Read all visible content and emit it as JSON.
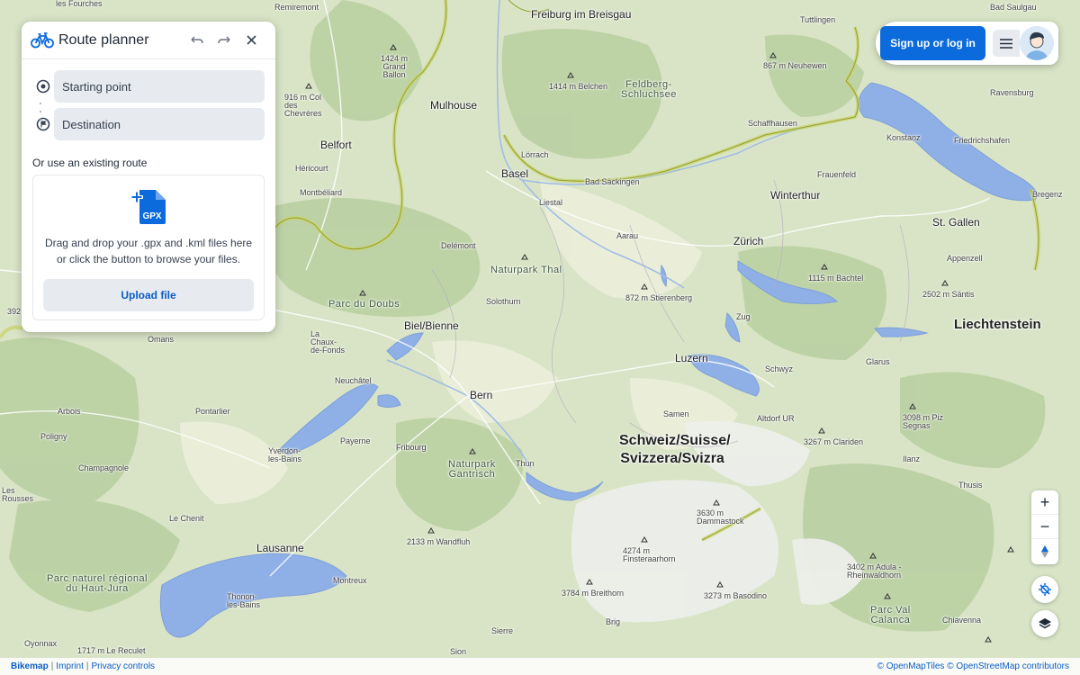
{
  "planner": {
    "title": "Route planner",
    "start_placeholder": "Starting point",
    "destination_placeholder": "Destination",
    "existing_label": "Or use an existing route",
    "file_badge": "GPX",
    "drop_line1": "Drag and drop your .gpx and .kml files here",
    "drop_line2": "or click the button to browse your files.",
    "upload_label": "Upload file",
    "accent_color": "#0b6bdc"
  },
  "header": {
    "signup_label": "Sign up or log in"
  },
  "map": {
    "labels": {
      "freiburg": "Freiburg im Breisgau",
      "mulhouse": "Mulhouse",
      "belfort": "Belfort",
      "basel": "Basel",
      "winterthur": "Winterthur",
      "zurich": "Zürich",
      "stgallen": "St. Gallen",
      "liechtenstein": "Liechtenstein",
      "bielbienne": "Biel/Bienne",
      "luzern": "Luzern",
      "bern": "Bern",
      "country1": "Schweiz/Suisse/",
      "country2": "Svizzera/Svizra",
      "lausanne": "Lausanne",
      "parcdoubs": "Parc du Doubs",
      "naturparkthal": "Naturpark Thal",
      "feldberg1": "Feldberg-",
      "feldberg2": "Schluchsee",
      "gantrisch1": "Naturpark",
      "gantrisch2": "Gantrisch",
      "hautjura1": "Parc naturel régional",
      "hautjura2": "du Haut-Jura",
      "parcval1": "Parc Val",
      "parcval2": "Calanca",
      "schaffhausen": "Schaffhausen",
      "konstanz": "Konstanz",
      "friedrichshafen": "Friedrichshafen",
      "ravensburg": "Ravensburg",
      "badsaulgau": "Bad Saulgau",
      "tuttlingen": "Tuttlingen",
      "neuhewen": "867 m Neuhewen",
      "belchen": "1414 m Belchen",
      "grandballon": "1424 m Grand Ballon",
      "coldes": "916 m Col des Chevrères",
      "remiremont": "Remiremont",
      "lorrach": "Lörrach",
      "badsackingen": "Bad Säckingen",
      "liestal": "Liestal",
      "frauenfeld": "Frauenfeld",
      "delemont": "Delémont",
      "aarau": "Aarau",
      "montbeliard": "Montbéliard",
      "hericourt": "Héricourt",
      "bregenz": "Bregenz",
      "appenzell": "Appenzell",
      "santis": "2502 m Säntis",
      "bachtel": "1115 m Bachtel",
      "stierenberg": "872 m Stierenberg",
      "solothurn": "Solothurn",
      "zug": "Zug",
      "schwyz": "Schwyz",
      "glarus": "Glarus",
      "lachaux": "La Chaux-de-Fonds",
      "omans": "Omans",
      "neuchatel": "Neuchâtel",
      "pontarlier": "Pontarlier",
      "arbois": "Arbois",
      "poligny": "Poligny",
      "champagnole": "Champagnole",
      "yverdon": "Yverdon-les-Bains",
      "payerne": "Payerne",
      "fribourg": "Fribourg",
      "thun": "Thun",
      "samen": "Samen",
      "altdorf": "Altdorf UR",
      "piz": "3098 m Piz Segnas",
      "claridenm": "3267 m Clariden",
      "ilanz": "Ilanz",
      "thusis": "Thusis",
      "dammastock": "3630 m Dammastock",
      "finsteraarhorn": "4274 m Finsteraarhorn",
      "breithorn": "3784 m Breithorn",
      "basodino": "3273 m Basodino",
      "adula": "3402 m Adula - Rheinwaldhorn",
      "wandfluh": "2133 m Wandfluh",
      "lechenit": "Le Chenit",
      "lesrousses": "Les Rousses",
      "thonon": "Thonon-les-Bains",
      "montreux": "Montreux",
      "brig": "Brig",
      "sierre": "Sierre",
      "sion": "Sion",
      "chiavenna": "Chiavenna",
      "oyonnax": "Oyonnax",
      "recule": "1717 m Le Reculet",
      "lesfourches": "les Fourches",
      "n392": "392"
    }
  },
  "footer": {
    "brand": "Bikemap",
    "imprint": "Imprint",
    "privacy": "Privacy controls",
    "attr1": "© OpenMapTiles",
    "attr2": "© OpenStreetMap contributors"
  },
  "controls": {
    "zoom_in": "+",
    "zoom_out": "−"
  }
}
